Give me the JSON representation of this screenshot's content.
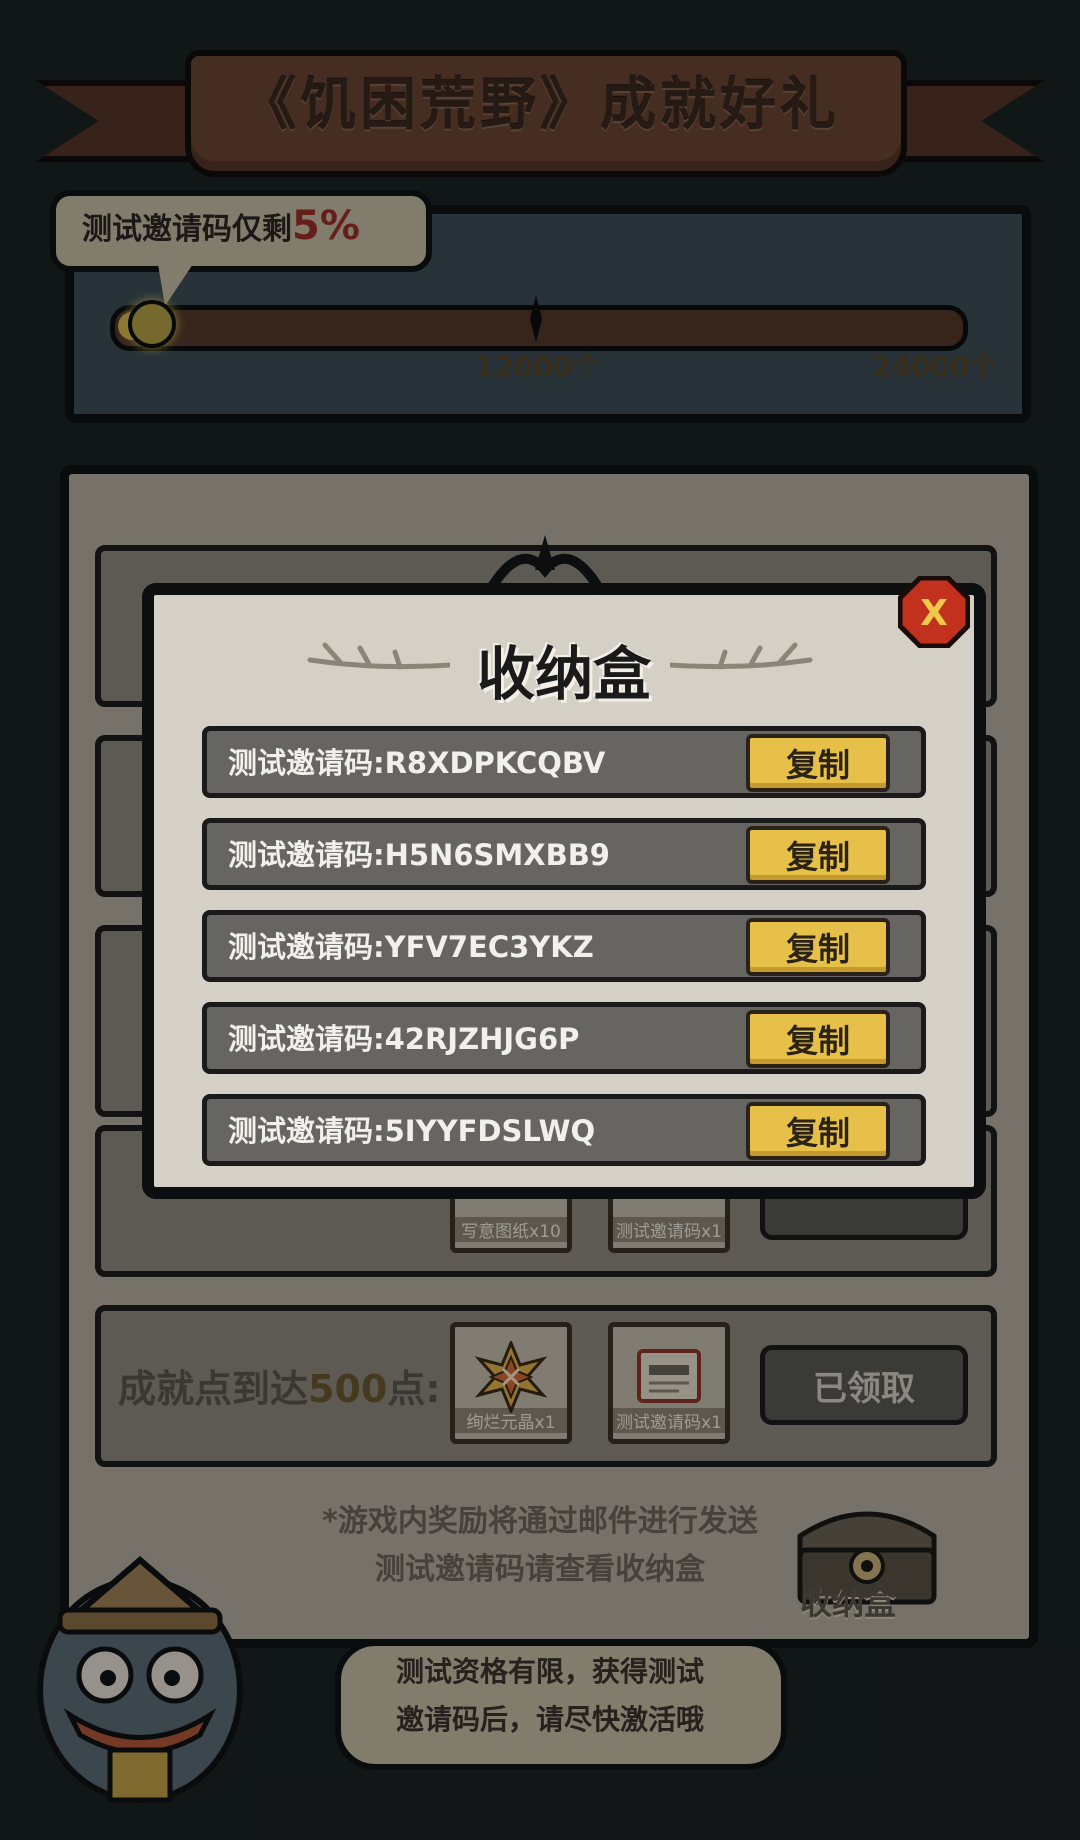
{
  "banner": {
    "title": "《饥困荒野》成就好礼"
  },
  "progress": {
    "tooltip_prefix": "测试邀请码仅剩",
    "tooltip_percent": "5%",
    "fill_fraction": 0.02,
    "milestones": [
      "12000个",
      "24000个"
    ]
  },
  "achievements": {
    "rows": [
      {
        "label_prefix": "成就点到达",
        "points": "500",
        "label_suffix": "点:",
        "rewards": [
          "绚烂元晶x1",
          "测试邀请码x1"
        ],
        "button": "已领取"
      }
    ],
    "hidden_row_rewards": [
      "写意图纸x10",
      "测试邀请码x1"
    ]
  },
  "footer": {
    "hint_line1": "*游戏内奖励将通过邮件进行发送",
    "hint_line2": "测试邀请码请查看收纳盒",
    "chest_label": "收纳盒",
    "speech_line1": "测试资格有限，获得测试",
    "speech_line2": "邀请码后，请尽快激活哦"
  },
  "modal": {
    "title": "收纳盒",
    "close_label": "X",
    "copy_label": "复制",
    "codes": [
      "测试邀请码:R8XDPKCQBV",
      "测试邀请码:H5N6SMXBB9",
      "测试邀请码:YFV7EC3YKZ",
      "测试邀请码:42RJZHJG6P",
      "测试邀请码:5IYYFDSLWQ"
    ]
  },
  "colors": {
    "background": "#1b2224",
    "board": "#b6b0a2",
    "accent_gold": "#e7c04a",
    "percent_red": "#9b2e28"
  }
}
